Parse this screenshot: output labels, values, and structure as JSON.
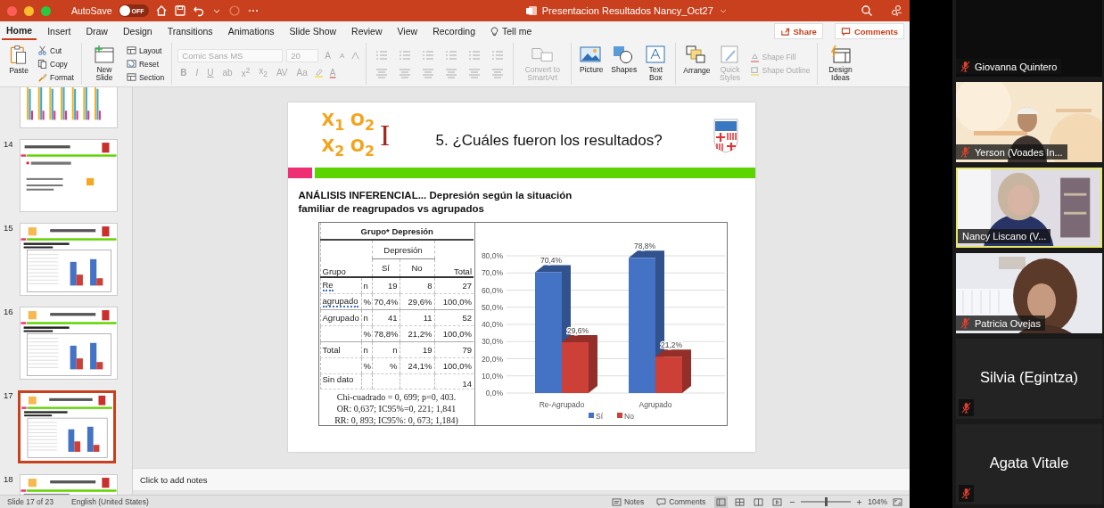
{
  "window": {
    "title": "Presentacion Resultados Nancy_Oct27",
    "autosave_label": "AutoSave",
    "autosave_state": "OFF",
    "autosave_on": false
  },
  "tabs": [
    {
      "label": "Home",
      "selected": true
    },
    {
      "label": "Insert",
      "selected": false
    },
    {
      "label": "Draw",
      "selected": false
    },
    {
      "label": "Design",
      "selected": false
    },
    {
      "label": "Transitions",
      "selected": false
    },
    {
      "label": "Animations",
      "selected": false
    },
    {
      "label": "Slide Show",
      "selected": false
    },
    {
      "label": "Review",
      "selected": false
    },
    {
      "label": "View",
      "selected": false
    },
    {
      "label": "Recording",
      "selected": false
    }
  ],
  "tell_me": "Tell me",
  "share": "Share",
  "comments": "Comments",
  "ribbon": {
    "paste": "Paste",
    "clipboard": [
      "Cut",
      "Copy",
      "Format"
    ],
    "new_slide": "New Slide",
    "slide_items": [
      "Layout",
      "Reset",
      "Section"
    ],
    "font": {
      "name": "Comic Sans MS",
      "size": "20",
      "disabled": true,
      "size_letters": [
        "A",
        "A"
      ],
      "styles": [
        "B",
        "I",
        "U",
        "ab",
        "x$^{2}$",
        "x$_{2}$",
        "AV",
        "Aa"
      ],
      "color_letter": "A"
    },
    "paragraph": {
      "disabled": true
    },
    "smartart": {
      "label": "Convert to SmartArt",
      "disabled": true
    },
    "insert": [
      "Picture",
      "Shapes",
      "Text Box"
    ],
    "arrange": "Arrange",
    "quick_styles": {
      "label": "Quick Styles",
      "disabled": true
    },
    "shape_fill": {
      "label": "Shape Fill",
      "disabled": true
    },
    "shape_outline": {
      "label": "Shape Outline",
      "disabled": true
    },
    "design_ideas": "Design Ideas"
  },
  "thumbnails": [
    {
      "kind": "bars",
      "selected": false
    },
    {
      "number": "14",
      "kind": "text",
      "selected": false
    },
    {
      "number": "15",
      "kind": "table-chart",
      "selected": false
    },
    {
      "number": "16",
      "kind": "table-chart",
      "selected": false
    },
    {
      "number": "17",
      "kind": "table-chart",
      "selected": true
    },
    {
      "number": "18",
      "kind": "table-chart",
      "selected": false
    }
  ],
  "slide": {
    "logo_lines": [
      "X$_{1}$ O$_{2}$",
      "X$_{2}$ O$_{2}$"
    ],
    "logo_mark": "I",
    "title": "5. ¿Cuáles fueron los resultados?",
    "heading": "ANÁLISIS INFERENCIAL...   Depresión según la situación\nfamiliar de reagrupados vs agrupados",
    "table": {
      "title": "Grupo* Depresión",
      "group_header": "Grupo",
      "span_header": "Depresión",
      "columns": [
        "Sí",
        "No"
      ],
      "total_header": "Total",
      "rows": [
        {
          "label": "Re",
          "flagged": true,
          "stat": "n",
          "si": "19",
          "no": "8",
          "total": "27"
        },
        {
          "label": "agrupado",
          "flagged": true,
          "stat": "%",
          "si": "70,4%",
          "no": "29,6%",
          "total": "100,0%"
        },
        {
          "label": "Agrupado",
          "flagged": false,
          "stat": "n",
          "si": "41",
          "no": "11",
          "total": "52"
        },
        {
          "stat": "%",
          "si": "78,8%",
          "no": "21,2%",
          "total": "100,0%"
        },
        {
          "label": "Total",
          "flagged": false,
          "stat": "n",
          "si": "n",
          "no": "19",
          "total": "79"
        },
        {
          "stat": "%",
          "si": "%",
          "no": "24,1%",
          "total": "100,0%"
        },
        {
          "label": "Sin dato",
          "flagged": false,
          "total": "14"
        }
      ],
      "notes": [
        "Chi-cuadrado = 0, 699; p=0, 403.",
        "OR: 0,637; IC95%=0, 221; 1,841",
        "RR: 0, 893; IC95%: 0, 673; 1,184)"
      ]
    },
    "chart": {
      "chart_data": {
        "type": "bar",
        "legend": "bottom",
        "grid": true,
        "categories": [
          "Re-Agrupado",
          "Agrupado"
        ],
        "series": [
          {
            "name": "Sí",
            "color": "#4472c4",
            "values": [
              70.4,
              78.8
            ]
          },
          {
            "name": "No",
            "color": "#cc4038",
            "values": [
              29.6,
              21.2
            ]
          }
        ],
        "ylim": [
          0,
          80
        ],
        "yticks": [
          {
            "value": 0,
            "label": "0,0%"
          },
          {
            "value": 10,
            "label": "10,0%"
          },
          {
            "value": 20,
            "label": "20,0%"
          },
          {
            "value": 30,
            "label": "30,0%"
          },
          {
            "value": 40,
            "label": "40,0%"
          },
          {
            "value": 50,
            "label": "50,0%"
          },
          {
            "value": 60,
            "label": "60,0%"
          },
          {
            "value": 70,
            "label": "70,0%"
          },
          {
            "value": 80,
            "label": "80,0%"
          }
        ],
        "value_labels": [
          [
            "70,4%",
            "78,8%"
          ],
          [
            "29,6%",
            "21,2%"
          ]
        ]
      }
    }
  },
  "notes": {
    "placeholder": "Click to add notes"
  },
  "status_bar": {
    "slide": "Slide 17 of 23",
    "language": "English (United States)",
    "notes": "Notes",
    "comments": "Comments",
    "views": [
      {
        "selected": true
      },
      {
        "selected": false
      },
      {
        "selected": false
      },
      {
        "selected": false
      }
    ],
    "zoom_slider": {
      "level": 0.5
    },
    "zoom": "104%"
  },
  "participants": [
    {
      "name": "Giovanna Quintero",
      "kind": "blank",
      "muted": true,
      "speaking": false
    },
    {
      "name": "Yerson (Voades In...",
      "kind": "video",
      "muted": true,
      "speaking": false
    },
    {
      "name": "Nancy Liscano (V...",
      "kind": "video",
      "muted": false,
      "speaking": true
    },
    {
      "name": "Patricia Ovejas",
      "kind": "video",
      "muted": true,
      "speaking": false
    },
    {
      "name": "Silvia (Egintza)",
      "kind": "name",
      "muted": true,
      "speaking": false
    },
    {
      "name": "Agata Vitale",
      "kind": "name",
      "muted": true,
      "speaking": false
    }
  ]
}
